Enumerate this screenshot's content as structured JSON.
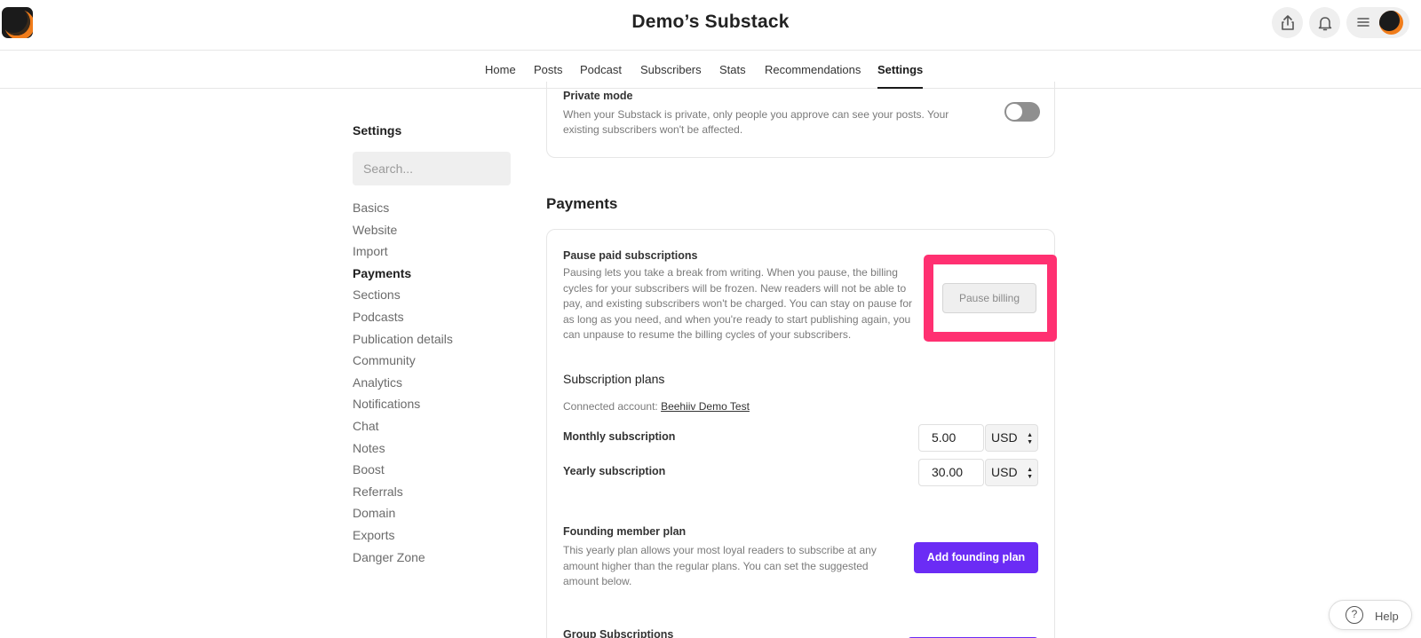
{
  "header": {
    "site_title": "Demo’s Substack",
    "icons": [
      "share-icon",
      "bell-icon",
      "menu-icon"
    ]
  },
  "nav": {
    "tabs": [
      {
        "label": "Home"
      },
      {
        "label": "Posts"
      },
      {
        "label": "Podcast"
      },
      {
        "label": "Subscribers"
      },
      {
        "label": "Stats"
      },
      {
        "label": "Recommendations"
      },
      {
        "label": "Settings",
        "active": true
      }
    ]
  },
  "sidebar": {
    "title": "Settings",
    "search_placeholder": "Search...",
    "items": [
      {
        "label": "Basics"
      },
      {
        "label": "Website"
      },
      {
        "label": "Import"
      },
      {
        "label": "Payments",
        "active": true
      },
      {
        "label": "Sections"
      },
      {
        "label": "Podcasts"
      },
      {
        "label": "Publication details"
      },
      {
        "label": "Community"
      },
      {
        "label": "Analytics"
      },
      {
        "label": "Notifications"
      },
      {
        "label": "Chat"
      },
      {
        "label": "Notes"
      },
      {
        "label": "Boost"
      },
      {
        "label": "Referrals"
      },
      {
        "label": "Domain"
      },
      {
        "label": "Exports"
      },
      {
        "label": "Danger Zone"
      }
    ]
  },
  "private_mode": {
    "title": "Private mode",
    "description": "When your Substack is private, only people you approve can see your posts. Your existing subscribers won't be affected.",
    "enabled": false
  },
  "payments": {
    "heading": "Payments",
    "pause": {
      "title": "Pause paid subscriptions",
      "description": "Pausing lets you take a break from writing. When you pause, the billing cycles for your subscribers will be frozen. New readers will not be able to pay, and existing subscribers won't be charged. You can stay on pause for as long as you need, and when you're ready to start publishing again, you can unpause to resume the billing cycles of your subscribers.",
      "button_label": "Pause billing"
    },
    "plans": {
      "title": "Subscription plans",
      "connected_prefix": "Connected account: ",
      "connected_account": "Beehiiv Demo Test",
      "monthly_label": "Monthly subscription",
      "monthly_price": "5.00",
      "monthly_currency": "USD",
      "yearly_label": "Yearly subscription",
      "yearly_price": "30.00",
      "yearly_currency": "USD"
    },
    "founding": {
      "title": "Founding member plan",
      "description": "This yearly plan allows your most loyal readers to subscribe at any amount higher than the regular plans. You can set the suggested amount below.",
      "button_label": "Add founding plan"
    },
    "group": {
      "title": "Group Subscriptions"
    }
  },
  "help": {
    "label": "Help"
  },
  "colors": {
    "accent_purple": "#6b2cf5",
    "highlight_pink": "#ff3071"
  }
}
